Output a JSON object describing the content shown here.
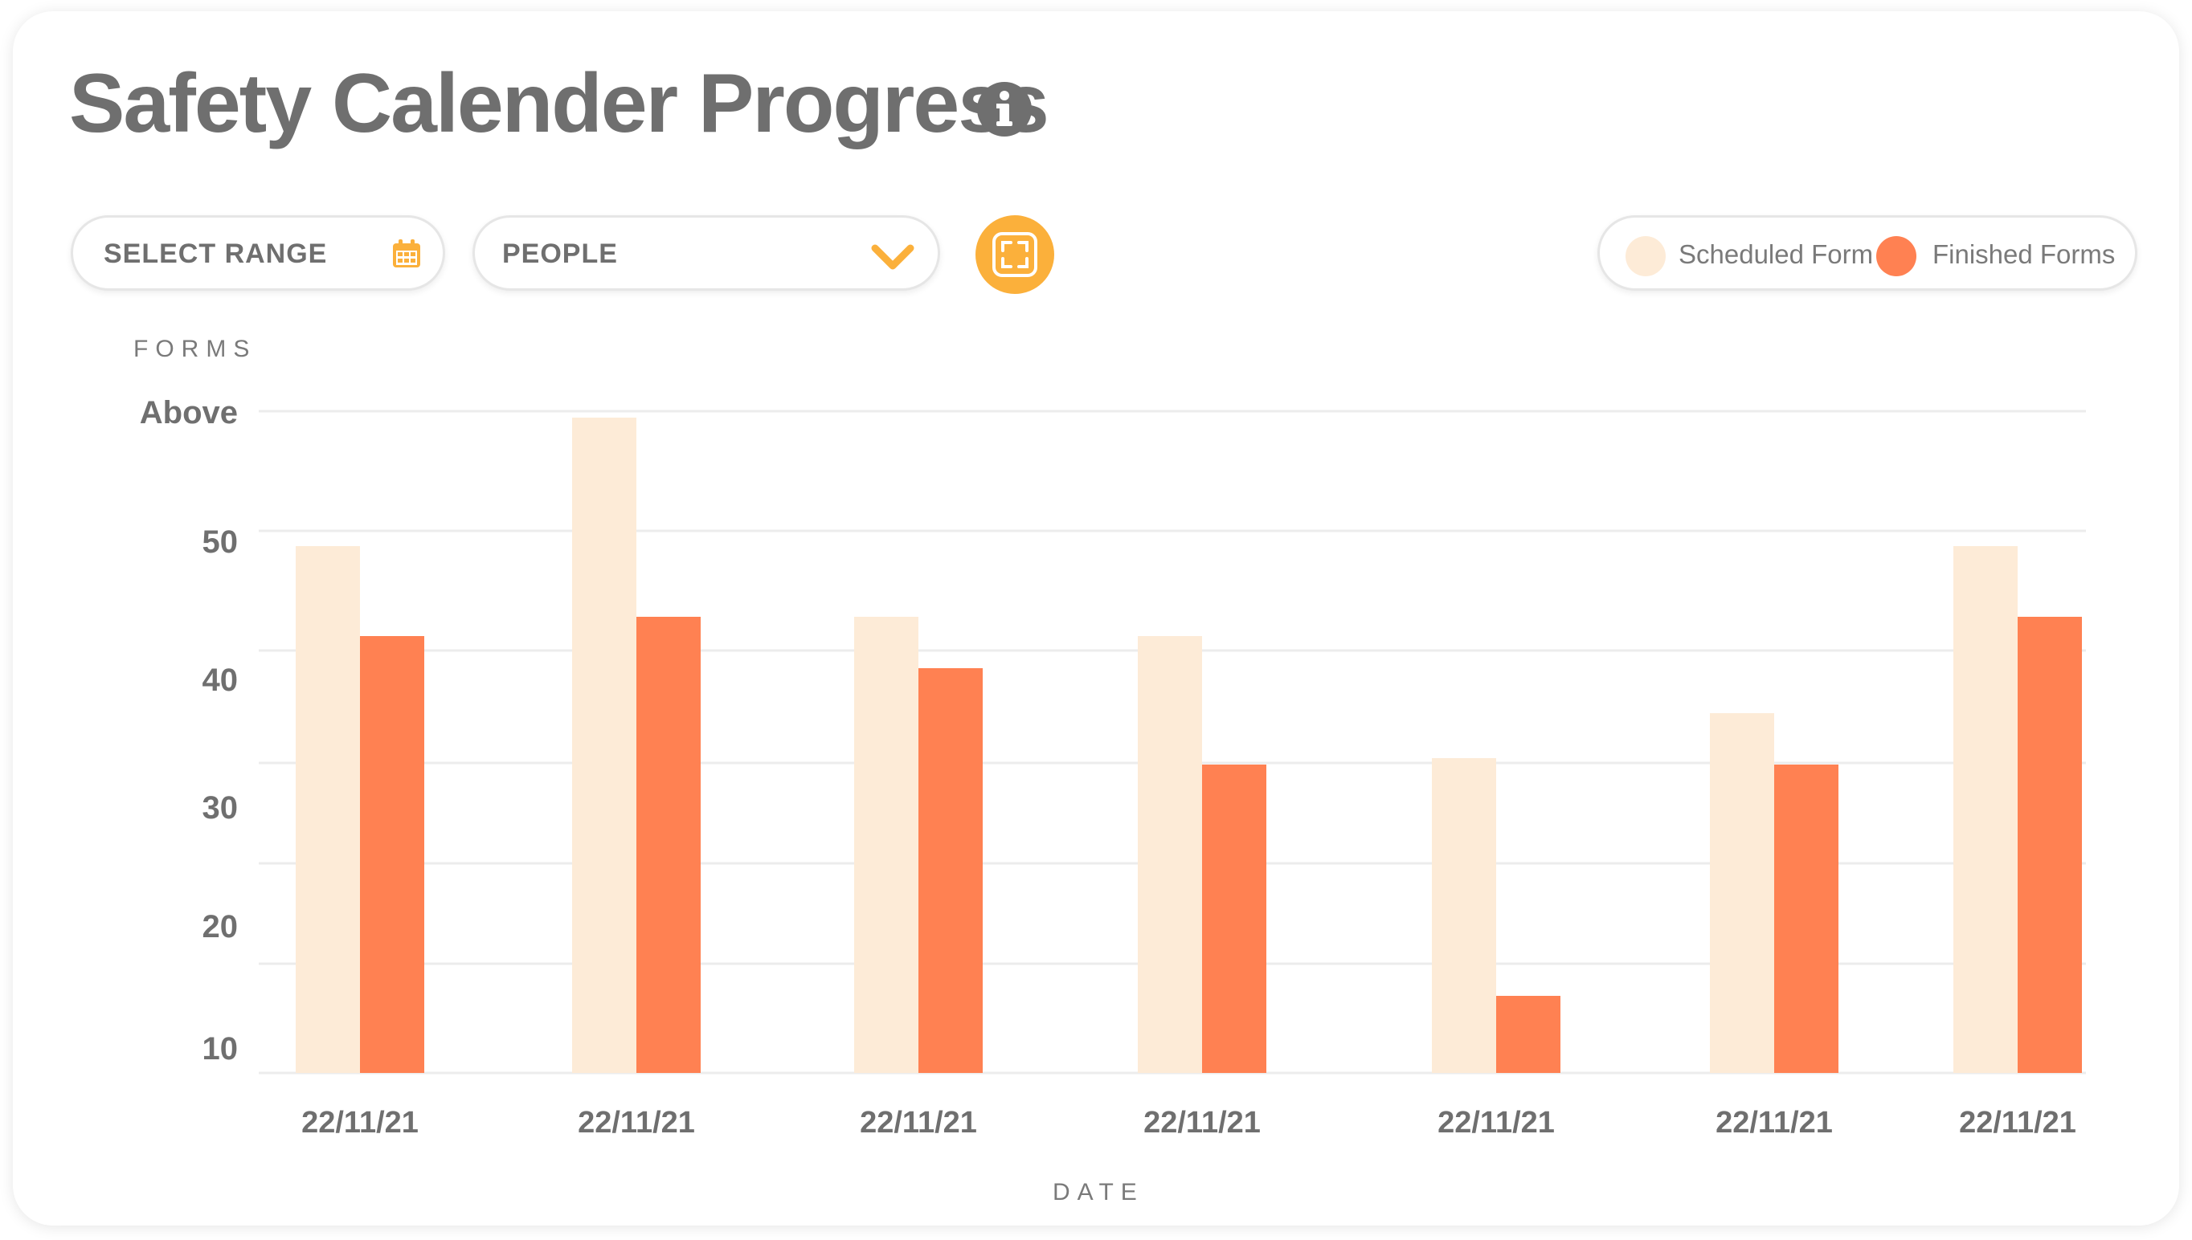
{
  "header": {
    "title": "Safety Calender Progress",
    "info_icon": "info-icon"
  },
  "controls": {
    "range_label": "SELECT RANGE",
    "range_icon": "calendar-icon",
    "people_label": "PEOPLE",
    "people_icon": "chevron-down-icon",
    "expand_icon": "expand-icon",
    "accent_color": "#fbb03b"
  },
  "legend": {
    "items": [
      {
        "label": "Scheduled Form",
        "color": "#fdebd7"
      },
      {
        "label": "Finished Forms",
        "color": "#ff8152"
      }
    ]
  },
  "chart_data": {
    "type": "bar",
    "ylabel": "FORMS",
    "xlabel": "DATE",
    "y_tick_labels": [
      "Above",
      "50",
      "40",
      "30",
      "20",
      "10"
    ],
    "ylim": [
      5,
      60
    ],
    "grid": true,
    "legend_position": "top-right",
    "categories": [
      "22/11/21",
      "22/11/21",
      "22/11/21",
      "22/11/21",
      "22/11/21",
      "22/11/21",
      "22/11/21"
    ],
    "series": [
      {
        "name": "Scheduled Form",
        "color": "#fdebd7",
        "values": [
          46,
          56,
          40.5,
          39,
          29.5,
          33,
          46
        ]
      },
      {
        "name": "Finished Forms",
        "color": "#ff8152",
        "values": [
          39,
          40.5,
          36.5,
          29,
          11,
          29,
          40.5
        ]
      }
    ]
  }
}
